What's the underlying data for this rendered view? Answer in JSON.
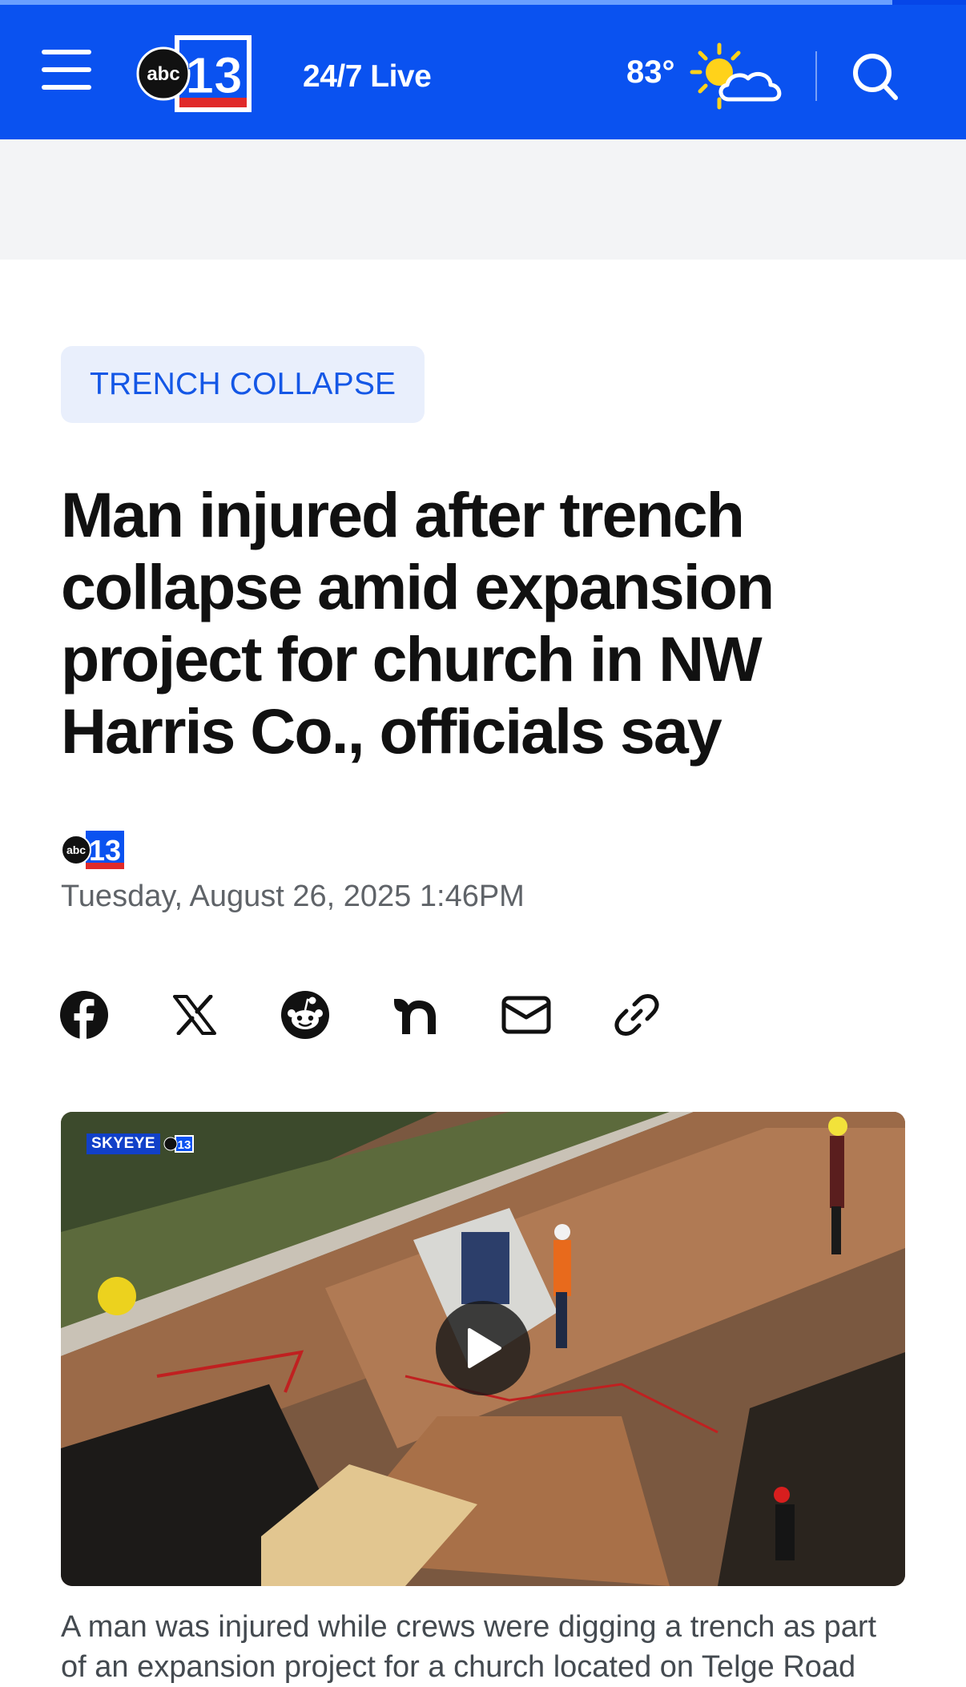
{
  "header": {
    "live_label": "24/7 Live",
    "temperature": "83°",
    "weather_icon": "partly-sunny-icon",
    "logo_text": "abc",
    "logo_number": "13",
    "brand_blue": "#0a52f0",
    "brand_red": "#e02a2a"
  },
  "article": {
    "category_tag": "TRENCH COLLAPSE",
    "headline": "Man injured after trench collapse amid expansion project for church in NW Harris Co., officials say",
    "dateline": "Tuesday, August 26, 2025 1:46PM",
    "share_icons": [
      "facebook-icon",
      "x-icon",
      "reddit-icon",
      "nextdoor-icon",
      "email-icon",
      "link-icon"
    ],
    "video": {
      "badge_text": "SKYEYE",
      "play_icon": "play-icon"
    },
    "caption": "A man was injured while crews were digging a trench as part of an expansion project for a church located on Telge Road"
  }
}
